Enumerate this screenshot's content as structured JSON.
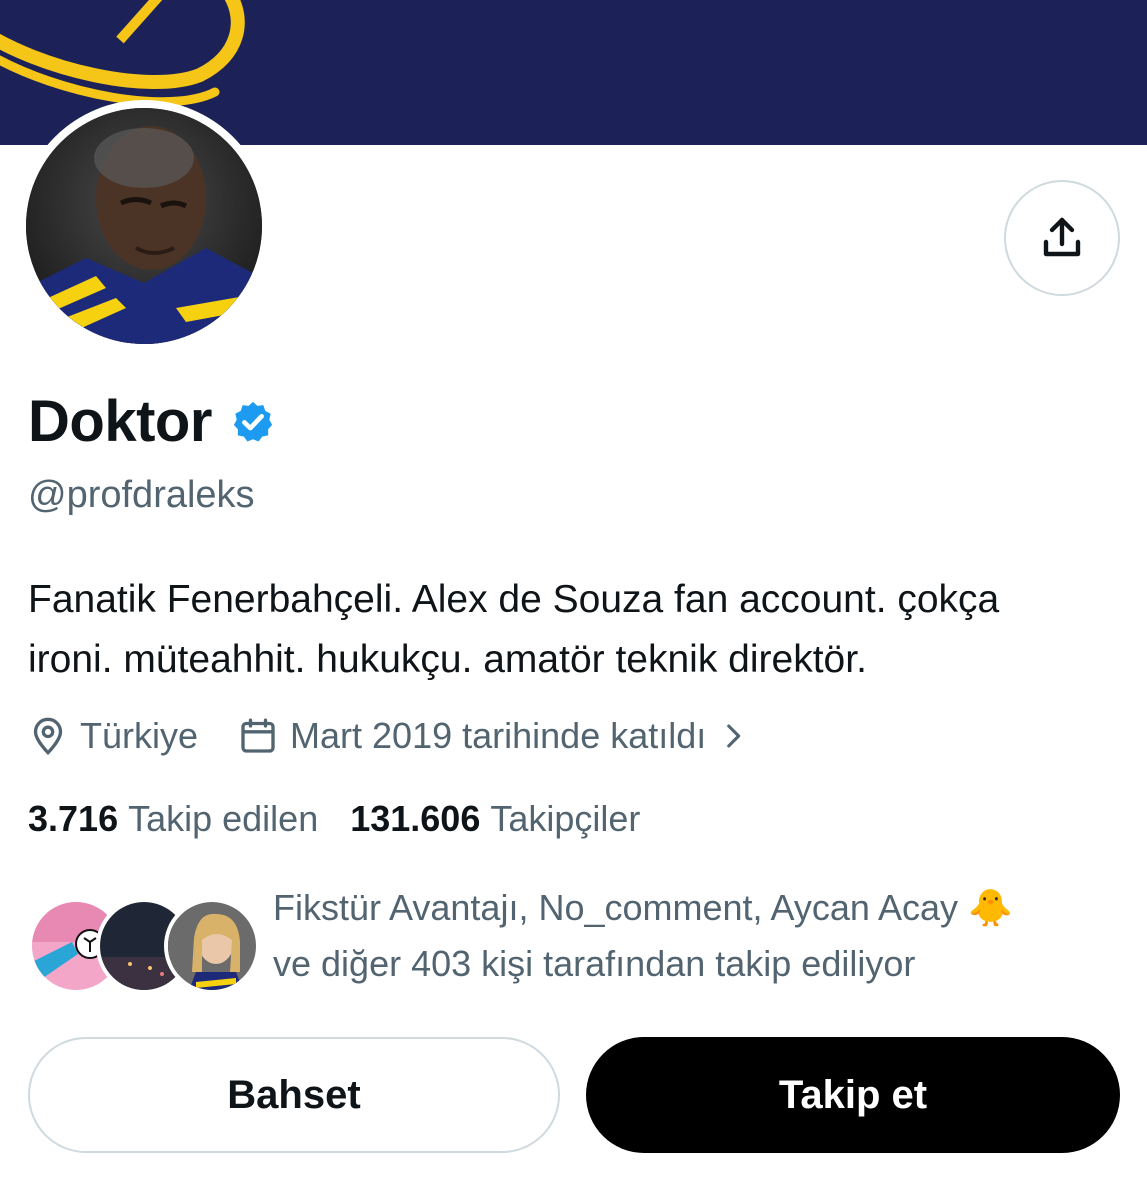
{
  "profile": {
    "display_name": "Doktor",
    "handle": "@profdraleks",
    "bio_line1": "Fanatik Fenerbahçeli. Alex de Souza fan account. çokça",
    "bio_line2": "ironi. müteahhit. hukukçu. amatör teknik direktör.",
    "location": "Türkiye",
    "joined": "Mart 2019 tarihinde katıldı"
  },
  "stats": {
    "following_count": "3.716",
    "following_label": "Takip edilen",
    "followers_count": "131.606",
    "followers_label": "Takipçiler"
  },
  "followed_by": {
    "line1": "Fikstür Avantajı, No_comment, Aycan Acay 🐥",
    "line2": "ve diğer 403 kişi tarafından takip ediliyor"
  },
  "actions": {
    "mention_label": "Bahset",
    "follow_label": "Takip et"
  },
  "icons": {
    "share": "share-upload-icon",
    "verified": "verified-badge-icon",
    "location": "location-pin-icon",
    "calendar": "calendar-icon",
    "chevron": "chevron-right-icon"
  },
  "colors": {
    "banner": "#1c2257",
    "banner_accent": "#f5c518",
    "verified": "#1d9bf0",
    "secondary_text": "#536471",
    "primary_text": "#0f1419"
  }
}
